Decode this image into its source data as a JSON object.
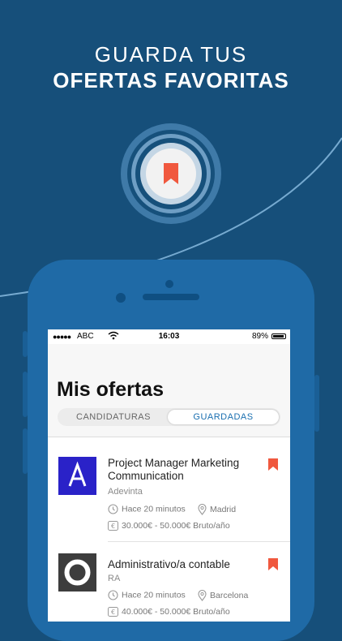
{
  "headline": {
    "line1": "GUARDA TUS",
    "line2": "OFERTAS FAVORITAS"
  },
  "colors": {
    "background": "#164f7a",
    "phone": "#1f6aa6",
    "accent": "#f0583e",
    "segment_active": "#1a6fb0"
  },
  "status_bar": {
    "signal": "●●●●●",
    "carrier": "ABC",
    "time": "16:03",
    "battery": "89%"
  },
  "screen": {
    "title": "Mis ofertas",
    "tabs": [
      {
        "label": "CANDIDATURAS",
        "active": false
      },
      {
        "label": "GUARDADAS",
        "active": true
      }
    ]
  },
  "jobs": [
    {
      "title": "Project Manager Marketing Communication",
      "company": "Adevinta",
      "posted": "Hace 20 minutos",
      "location": "Madrid",
      "salary": "30.000€ - 50.000€ Bruto/año",
      "logo_letter": "A"
    },
    {
      "title": "Administrativo/a contable",
      "company": "RA",
      "posted": "Hace 20 minutos",
      "location": "Barcelona",
      "salary": "40.000€ - 50.000€ Bruto/año"
    }
  ],
  "icons": {
    "badge": "bookmark-icon",
    "time": "clock-icon",
    "location": "location-pin-icon",
    "salary": "euro-icon",
    "saved": "bookmark-icon"
  }
}
